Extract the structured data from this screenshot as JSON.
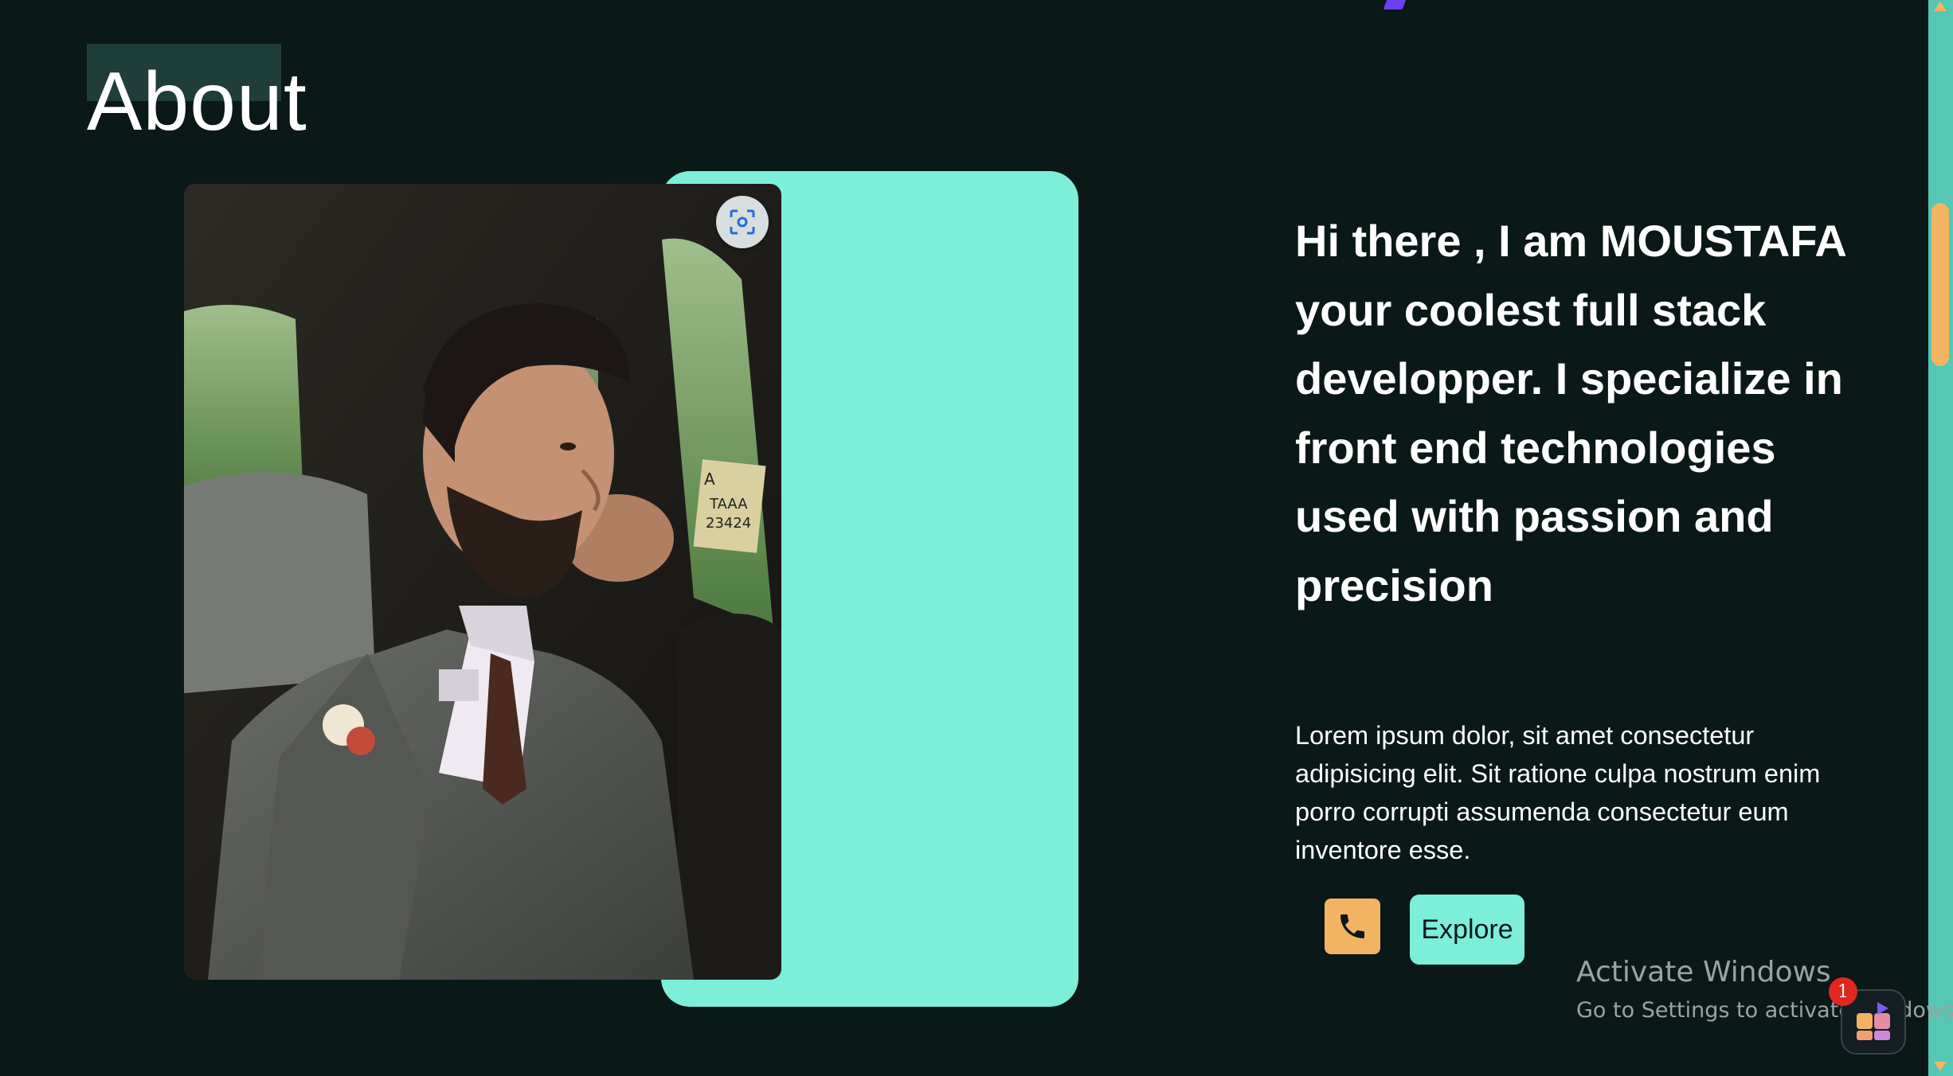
{
  "section": {
    "title": "About"
  },
  "hero": {
    "heading": "Hi there , I am MOUSTAFA your coolest full stack developper. I specialize in front end technologies used with passion and precision",
    "description": "Lorem ipsum dolor, sit amet consectetur adipisicing elit. Sit ratione culpa nostrum enim porro corrupti assumenda consectetur eum inventore esse."
  },
  "actions": {
    "phone_icon": "phone-icon",
    "explore_label": "Explore"
  },
  "photo": {
    "plate_text_1": "A",
    "plate_text_2": "TAAA",
    "plate_text_3": "23424"
  },
  "overlay": {
    "windows_title": "Activate Windows",
    "windows_subtitle": "Go to Settings to activate Windows.",
    "badge_count": "1"
  },
  "colors": {
    "background": "#0a1817",
    "accent_aqua": "#7ceeda",
    "accent_orange": "#f2b462",
    "title_highlight": "#1f3d39"
  }
}
